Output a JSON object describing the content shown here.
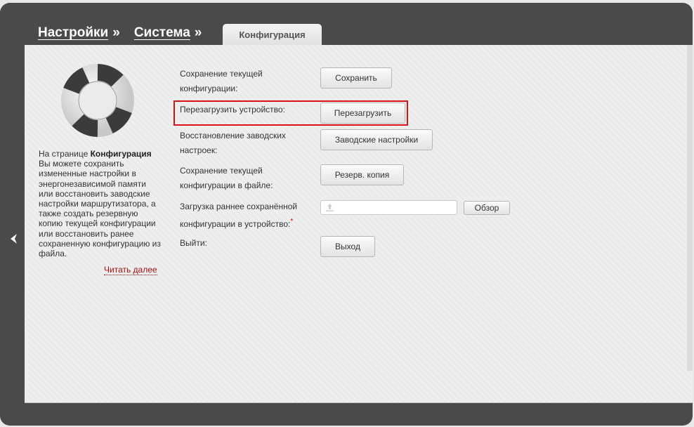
{
  "breadcrumb": {
    "items": [
      "Настройки",
      "Система"
    ],
    "separator": "»"
  },
  "active_tab": "Конфигурация",
  "sidebar": {
    "description_prefix": "На странице ",
    "description_bold": "Конфигурация",
    "description_rest": " Вы можете сохранить измененные настройки в энергонезависимой памяти или восстановить заводские настройки маршрутизатора, а также создать резервную копию текущей конфигурации или восстановить ранее сохраненную конфигурацию из файла.",
    "read_more": "Читать далее",
    "icon": "lifebuoy-icon"
  },
  "rows": {
    "save_label": "Сохранение текущей конфигурации:",
    "save_button": "Сохранить",
    "reboot_label": "Перезагрузить устройство:",
    "reboot_button": "Перезагрузить",
    "factory_label": "Восстановление заводских настроек:",
    "factory_button": "Заводские настройки",
    "backup_label": "Сохранение текущей конфигурации в файле:",
    "backup_button": "Резерв. копия",
    "upload_label": "Загрузка раннее сохранённой конфигурации в устройство:",
    "upload_required": "*",
    "browse_button": "Обзор",
    "exit_label": "Выйти:",
    "exit_button": "Выход"
  },
  "colors": {
    "frame": "#4a4a4a",
    "highlight": "#d9121a",
    "link": "#a01010"
  }
}
